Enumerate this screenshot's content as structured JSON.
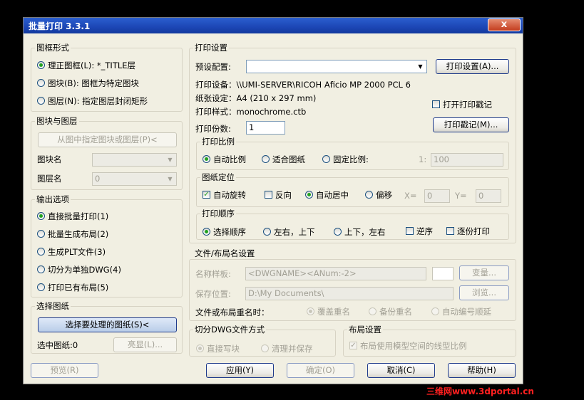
{
  "title": "批量打印 3.3.1",
  "close": "x",
  "frame": {
    "group": "图框形式",
    "opt1": "理正图框(L): *_TITLE层",
    "opt2": "图块(B): 图框为特定图块",
    "opt3": "图层(N): 指定图层封闭矩形"
  },
  "blocklayer": {
    "group": "图块与图层",
    "pick_btn": "从图中指定图块或图层(P)<",
    "block_label": "图块名",
    "layer_label": "图层名",
    "layer_value": "0"
  },
  "output": {
    "group": "输出选项",
    "opt1": "直接批量打印(1)",
    "opt2": "批量生成布局(2)",
    "opt3": "生成PLT文件(3)",
    "opt4": "切分为单独DWG(4)",
    "opt5": "打印已有布局(5)"
  },
  "select": {
    "group": "选择图纸",
    "btn": "选择要处理的图纸(S)<",
    "count": "选中图纸:0",
    "highlight": "亮显(L)..."
  },
  "print": {
    "group": "打印设置",
    "preset_label": "预设配置:",
    "preset_value": "",
    "setup_btn": "打印设置(A)...",
    "device": "打印设备：\\\\UMI-SERVER\\RICOH Aficio MP 2000 PCL 6",
    "paper": "纸张设定：A4 (210 x 297 mm)",
    "style": "打印样式：monochrome.ctb",
    "stamp_check": "打开打印戳记",
    "stamp_btn": "打印戳记(M)...",
    "copies_label": "打印份数:",
    "copies": "1"
  },
  "scale": {
    "group": "打印比例",
    "opt1": "自动比例",
    "opt2": "适合图纸",
    "opt3": "固定比例:",
    "ratio_prefix": "1:",
    "ratio_value": "100"
  },
  "position": {
    "group": "图纸定位",
    "autorotate": "自动旋转",
    "reverse": "反向",
    "center": "自动居中",
    "offset": "偏移",
    "x_label": "X=",
    "x_value": "0",
    "y_label": "Y=",
    "y_value": "0"
  },
  "order": {
    "group": "打印顺序",
    "opt1": "选择顺序",
    "opt2": "左右，上下",
    "opt3": "上下，左右",
    "reverse": "逆序",
    "collate": "逐份打印"
  },
  "file": {
    "group": "文件/布局名设置",
    "template_label": "名称样板:",
    "template_value": "<DWGNAME><ANum:-2>",
    "var_btn": "变量...",
    "save_label": "保存位置:",
    "save_value": "D:\\My Documents\\",
    "browse_btn": "浏览...",
    "rename_label": "文件或布局重名时：",
    "r1": "覆盖重名",
    "r2": "备份重名",
    "r3": "自动编号顺延"
  },
  "split": {
    "group": "切分DWG文件方式",
    "o1": "直接写块",
    "o2": "清理并保存"
  },
  "layout": {
    "group": "布局设置",
    "check": "布局使用模型空间的线型比例"
  },
  "bottom": {
    "preview": "预览(R)",
    "apply": "应用(Y)",
    "ok": "确定(O)",
    "cancel": "取消(C)",
    "help": "帮助(H)"
  },
  "watermark": "三维网www.3dportal.cn"
}
